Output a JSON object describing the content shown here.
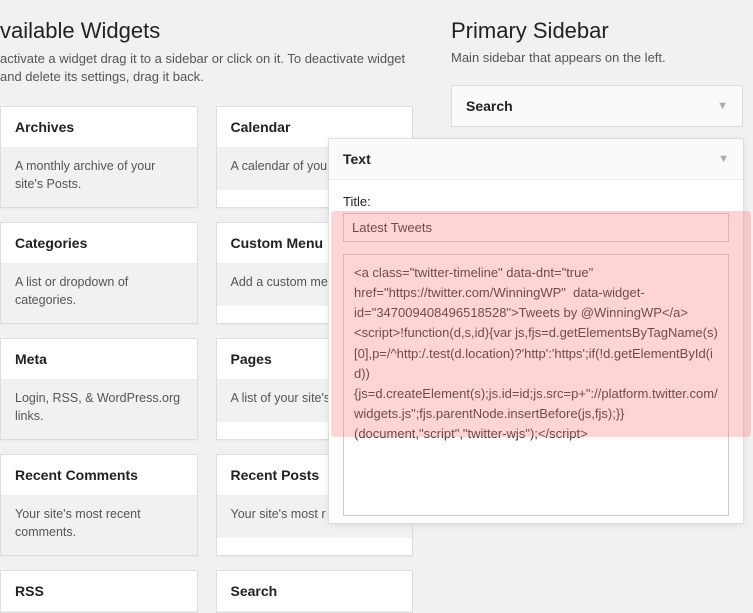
{
  "available": {
    "heading": "vailable Widgets",
    "sub": "activate a widget drag it to a sidebar or click on it. To deactivate widget and delete its settings, drag it back.",
    "widgets": [
      {
        "title": "Archives",
        "desc": "A monthly archive of your site's Posts."
      },
      {
        "title": "Calendar",
        "desc": "A calendar of you"
      },
      {
        "title": "Categories",
        "desc": "A list or dropdown of categories."
      },
      {
        "title": "Custom Menu",
        "desc": "Add a custom me sidebar."
      },
      {
        "title": "Meta",
        "desc": "Login, RSS, & WordPress.org links."
      },
      {
        "title": "Pages",
        "desc": "A list of your site's"
      },
      {
        "title": "Recent Comments",
        "desc": "Your site's most recent comments."
      },
      {
        "title": "Recent Posts",
        "desc": "Your site's most r"
      },
      {
        "title": "RSS",
        "desc": ""
      },
      {
        "title": "Search",
        "desc": ""
      }
    ]
  },
  "primary": {
    "heading": "Primary Sidebar",
    "sub": "Main sidebar that appears on the left.",
    "search_widget_label": "Search"
  },
  "text_widget": {
    "head_label": "Text",
    "title_label": "Title:",
    "title_value": "Latest Tweets",
    "content_value": "<a class=\"twitter-timeline\" data-dnt=\"true\" href=\"https://twitter.com/WinningWP\"  data-widget-id=\"347009408496518528\">Tweets by @WinningWP</a>    <script>!function(d,s,id){var js,fjs=d.getElementsByTagName(s)[0],p=/^http:/.test(d.location)?'http':'https';if(!d.getElementById(id)){js=d.createElement(s);js.id=id;js.src=p+\"://platform.twitter.com/widgets.js\";fjs.parentNode.insertBefore(js,fjs);}}(document,\"script\",\"twitter-wjs\");</script>"
  }
}
